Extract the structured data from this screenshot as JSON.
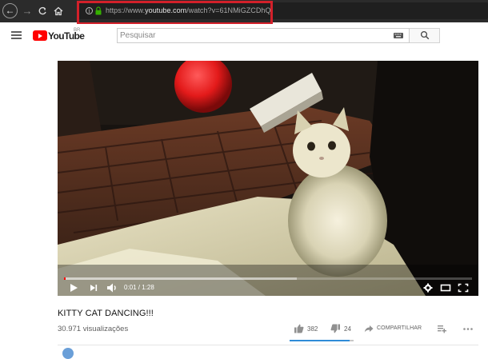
{
  "browser": {
    "url_prefix": "https://www.",
    "url_host": "youtube.com",
    "url_path": "/watch?v=61NMiGZCDhQ",
    "info_icon": "i",
    "highlight_color": "#d3202a"
  },
  "header": {
    "logo_text": "YouTube",
    "region": "BR",
    "search_placeholder": "Pesquisar"
  },
  "player": {
    "time": "0:01 / 1:28",
    "played_fraction": 0.003,
    "buffered_fraction": 0.57
  },
  "video": {
    "title": "KITTY CAT DANCING!!!",
    "views": "30.971 visualizações",
    "likes": "382",
    "dislikes": "24",
    "share_label": "COMPARTILHAR",
    "like_ratio": 0.94
  },
  "colors": {
    "brand_red": "#ff0000",
    "like_bar": "#2f8cd8"
  }
}
